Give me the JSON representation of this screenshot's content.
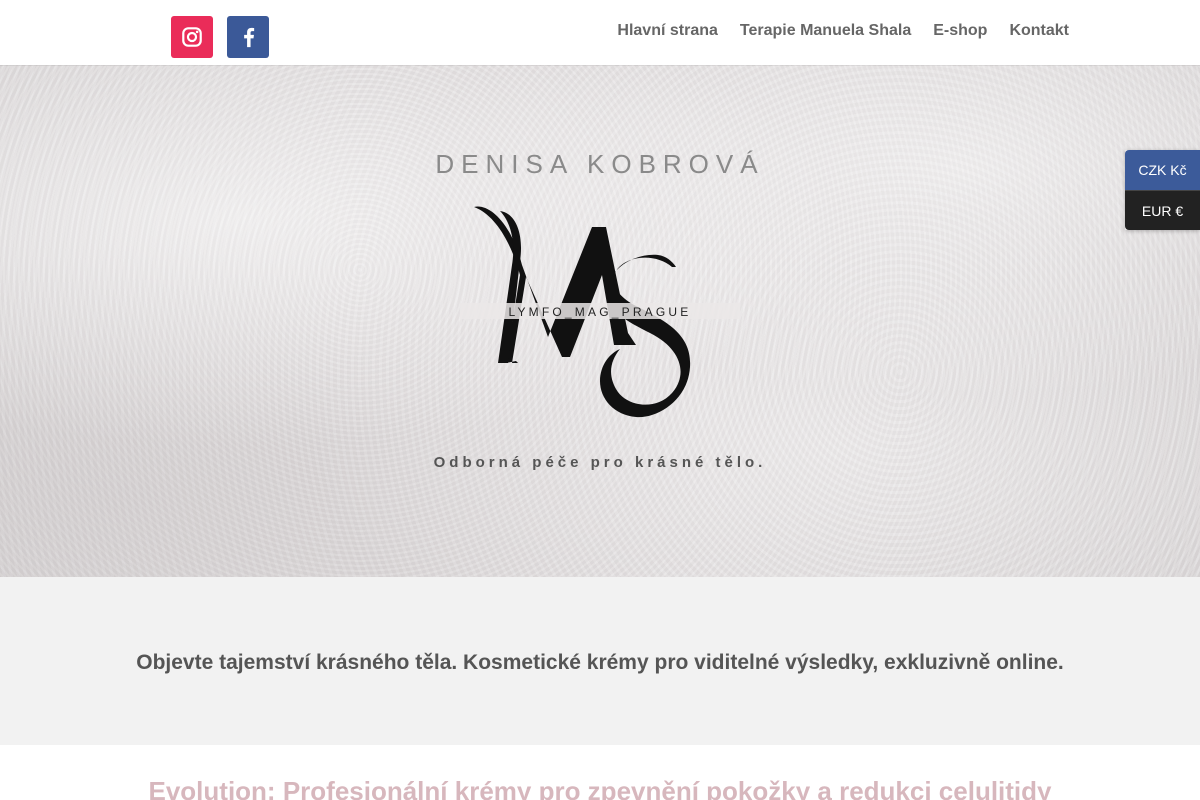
{
  "header": {
    "social": [
      {
        "name": "instagram-icon",
        "color": "#ea2c59"
      },
      {
        "name": "facebook-icon",
        "color": "#3b5998"
      }
    ],
    "nav": [
      {
        "label": "Hlavní strana"
      },
      {
        "label": "Terapie Manuela Shala"
      },
      {
        "label": "E-shop"
      },
      {
        "label": "Kontakt"
      }
    ]
  },
  "hero": {
    "title": "DENISA KOBROVÁ",
    "logo": {
      "monogram": "MS",
      "text": "LYMFO_MAG_PRAGUE"
    },
    "tagline": "Odborná péče pro krásné tělo."
  },
  "currency": {
    "options": [
      {
        "label": "CZK Kč",
        "active": true,
        "color": "#3c5b9a"
      },
      {
        "label": "EUR €",
        "active": false,
        "color": "#222222"
      }
    ]
  },
  "intro": {
    "text": "Objevte tajemství krásného těla. Kosmetické krémy pro viditelné výsledky, exkluzivně online."
  },
  "product": {
    "title": "Evolution: Profesionální krémy pro zpevnění pokožky a redukci celulitidy",
    "color": "#d7b7bd"
  }
}
